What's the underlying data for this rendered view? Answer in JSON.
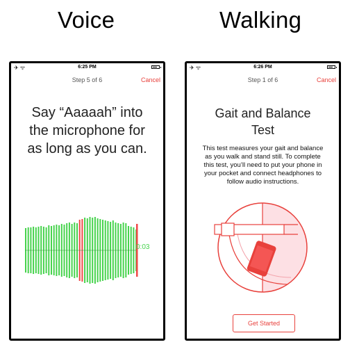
{
  "panels": {
    "voice": {
      "title": "Voice"
    },
    "walking": {
      "title": "Walking"
    }
  },
  "voice_screen": {
    "time": "6:25 PM",
    "step": "Step 5 of 6",
    "cancel": "Cancel",
    "prompt_line1": "Say “Aaaaah” into",
    "prompt_line2": "the microphone for",
    "prompt_line3": "as long as you can.",
    "timer": "0:03",
    "colors": {
      "wave_green": "#46d34c",
      "wave_red": "#f04848",
      "accent": "#e8413c"
    }
  },
  "walking_screen": {
    "time": "6:26 PM",
    "step": "Step 1 of 6",
    "cancel": "Cancel",
    "title_line1": "Gait and Balance",
    "title_line2": "Test",
    "description_lines": [
      "This test measures your gait and balance",
      "as you walk and stand still. To complete",
      "this test, you’ll need to put your phone in",
      "your pocket and connect headphones to",
      "follow audio instructions."
    ],
    "button": "Get Started"
  },
  "status_icons": {
    "left": "airplane-wifi-icons",
    "right": "battery-icon"
  }
}
